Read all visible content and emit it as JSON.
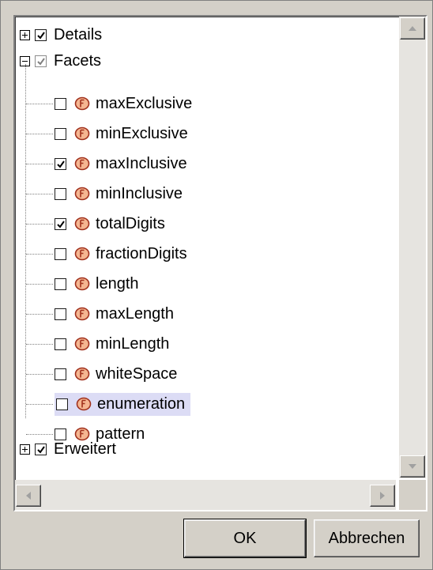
{
  "tree": {
    "details": {
      "label": "Details",
      "checked": true,
      "expanded": false
    },
    "facets": {
      "label": "Facets",
      "checked": true,
      "expanded": true,
      "items": [
        {
          "label": "maxExclusive",
          "checked": false
        },
        {
          "label": "minExclusive",
          "checked": false
        },
        {
          "label": "maxInclusive",
          "checked": true
        },
        {
          "label": "minInclusive",
          "checked": false
        },
        {
          "label": "totalDigits",
          "checked": true
        },
        {
          "label": "fractionDigits",
          "checked": false
        },
        {
          "label": "length",
          "checked": false
        },
        {
          "label": "maxLength",
          "checked": false
        },
        {
          "label": "minLength",
          "checked": false
        },
        {
          "label": "whiteSpace",
          "checked": false
        },
        {
          "label": "enumeration",
          "checked": false,
          "selected": true
        },
        {
          "label": "pattern",
          "checked": false
        }
      ]
    },
    "erweitert": {
      "label": "Erweitert",
      "checked": true,
      "expanded": false
    }
  },
  "buttons": {
    "ok": "OK",
    "cancel": "Abbrechen"
  },
  "colors": {
    "facet_icon_fill": "#f5b591",
    "facet_icon_stroke": "#a0301c",
    "selection": "#dcdcf5"
  }
}
